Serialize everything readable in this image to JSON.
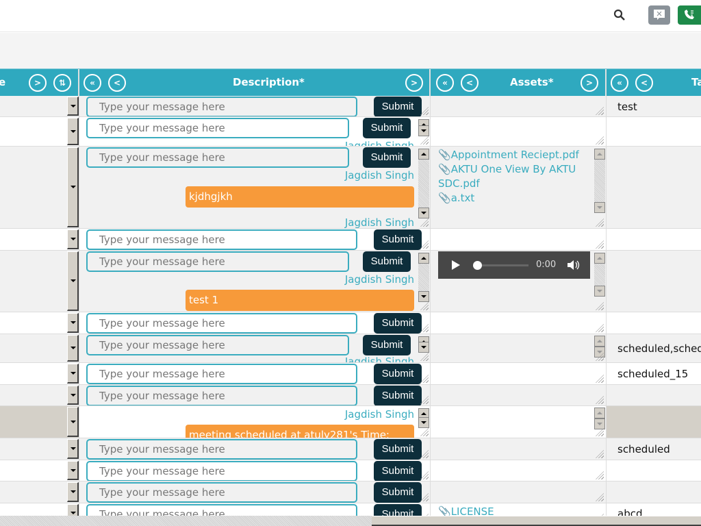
{
  "topbar": {
    "icons": [
      "search-icon",
      "chat-dismiss-icon",
      "call-log-icon"
    ]
  },
  "header": {
    "col1_label_fragment": "e",
    "col2_label": "Description*",
    "col3_label": "Assets*",
    "col4_label_fragment": "Ta",
    "first_btn": "«",
    "prev_btn": "<",
    "next_btn": ">",
    "sort_btn": "⇅"
  },
  "placeholder": "Type your message here",
  "submit_label": "Submit",
  "author": "Jagdish Singh",
  "rows": [
    {
      "tag": "test",
      "message": "",
      "assets": []
    },
    {
      "tag": "",
      "message": "",
      "assets": []
    },
    {
      "tag": "",
      "message": "kjdhgjkh",
      "assets": [
        "Appointment Reciept.pdf",
        "AKTU One View By AKTU SDC.pdf",
        "a.txt"
      ]
    },
    {
      "tag": "",
      "message": "",
      "assets": []
    },
    {
      "tag": "",
      "message": "test 1",
      "assets": [],
      "audio": {
        "time": "0:00",
        "progress": 0
      }
    },
    {
      "tag": "",
      "message": "",
      "assets": []
    },
    {
      "tag": "scheduled,sched",
      "message": "",
      "assets": []
    },
    {
      "tag": "scheduled_15",
      "message": "",
      "assets": []
    },
    {
      "tag": "",
      "message": "",
      "assets": []
    },
    {
      "tag": "",
      "message": "meeting scheduled at atuly281's Time:",
      "assets": []
    },
    {
      "tag": "scheduled",
      "message": "",
      "assets": []
    },
    {
      "tag": "",
      "message": "",
      "assets": []
    },
    {
      "tag": "",
      "message": "",
      "assets": []
    },
    {
      "tag": "abcd",
      "message": "",
      "assets": [
        "LICENSE"
      ]
    }
  ]
}
